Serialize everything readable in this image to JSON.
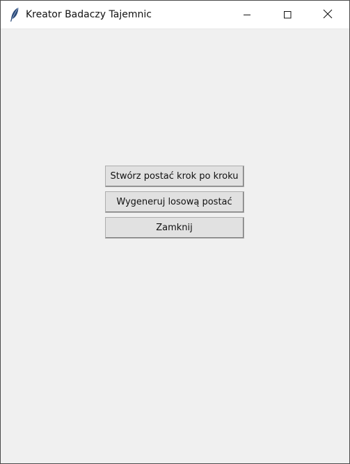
{
  "window": {
    "title": "Kreator Badaczy Tajemnic",
    "app_icon": "feather-icon",
    "controls": {
      "minimize_icon": "minimize-icon",
      "maximize_icon": "maximize-icon",
      "close_icon": "close-icon"
    }
  },
  "main": {
    "buttons": [
      {
        "label": "Stwórz postać krok po kroku"
      },
      {
        "label": "Wygeneruj losową postać"
      },
      {
        "label": "Zamknij"
      }
    ]
  },
  "colors": {
    "background": "#f0f0f0",
    "titlebar": "#ffffff",
    "button_face": "#e1e1e1"
  }
}
